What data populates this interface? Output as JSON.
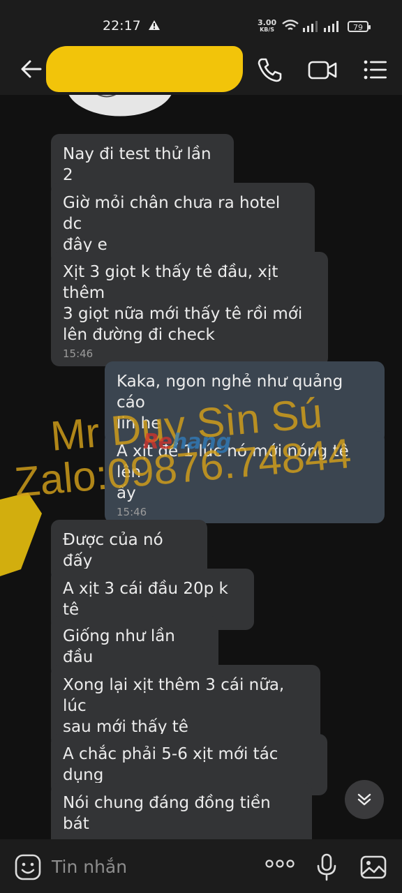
{
  "status_bar": {
    "time": "22:17",
    "net_speed_value": "3.00",
    "net_speed_unit": "KB/S",
    "battery": "79"
  },
  "header": {
    "icons": [
      "back-arrow-icon",
      "phone-icon",
      "video-call-icon",
      "menu-icon"
    ]
  },
  "messages": [
    {
      "direction": "in",
      "text": "Nay đi test thử lần 2",
      "time": ""
    },
    {
      "direction": "in",
      "text": "Giờ mỏi chân chưa ra hotel dc\nđây e",
      "time": ""
    },
    {
      "direction": "in",
      "text": "Xịt 3 giọt k thấy tê đầu, xịt thêm\n3 giọt nữa mới thấy tê rồi mới\nlên đường đi check",
      "time": "15:46"
    },
    {
      "direction": "out",
      "text": "Kaka, ngon nghẻ như quảng cáo\nlin he",
      "time": ""
    },
    {
      "direction": "out",
      "text": "A xịt để 1 lúc nó mới nóng tê lên\nấy",
      "time": "15:46"
    },
    {
      "direction": "in",
      "text": "Được của nó đấy",
      "time": ""
    },
    {
      "direction": "in",
      "text": "A xịt 3 cái đầu 20p k tê",
      "time": ""
    },
    {
      "direction": "in",
      "text": "Giống như lần đầu",
      "time": ""
    },
    {
      "direction": "in",
      "text": "Xong lại xịt thêm 3 cái nữa, lúc\nsau mới thấy tê",
      "time": ""
    },
    {
      "direction": "in",
      "text": "A chắc phải 5-6 xịt mới tác dụng",
      "time": ""
    },
    {
      "direction": "in",
      "text": "Nói chung đáng đồng tiền bát\ngạo",
      "time": ""
    }
  ],
  "watermark": {
    "line1": "Mr Duy Sìn Sú",
    "line2": "Zalo:09876.74844",
    "logo_part1": "Re",
    "logo_part2": "hang"
  },
  "composer": {
    "placeholder": "Tin nhắn"
  },
  "colors": {
    "background": "#111111",
    "incoming_bubble": "#333436",
    "outgoing_bubble": "#3b4550",
    "watermark": "#d4a01a",
    "redaction": "#f2c40a"
  }
}
